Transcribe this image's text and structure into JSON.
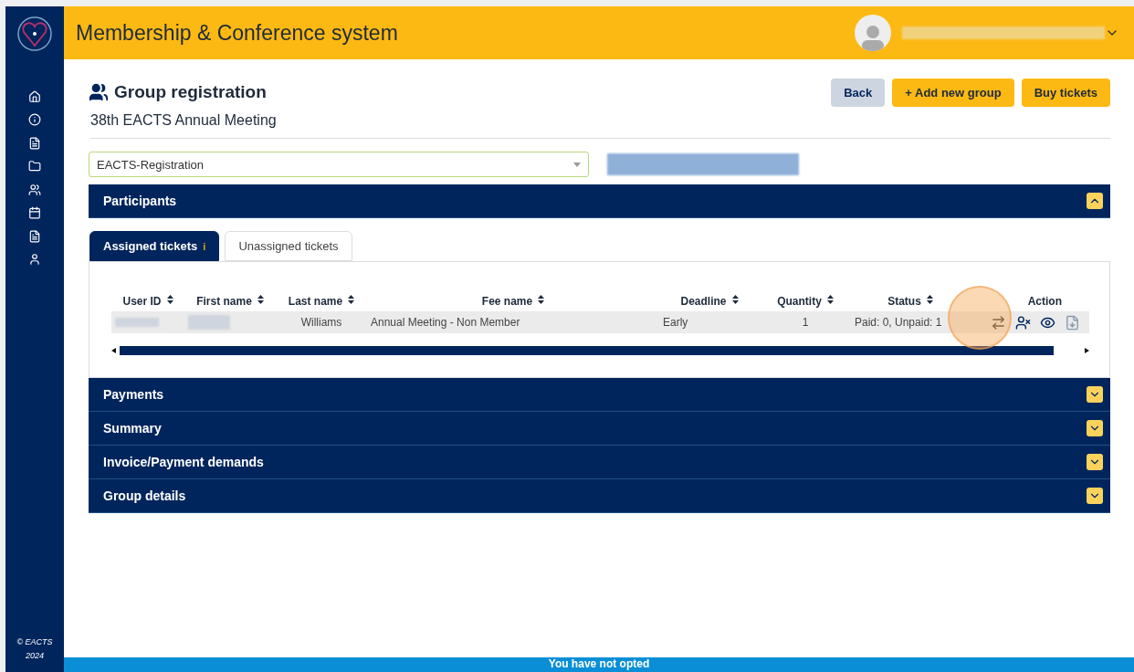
{
  "header": {
    "title": "Membership & Conference system"
  },
  "sidebar": {
    "copyright": [
      "© EACTS",
      "2024"
    ]
  },
  "page": {
    "title": "Group registration",
    "subtitle": "38th EACTS Annual Meeting",
    "buttons": [
      {
        "label": "Back",
        "kind": "secondary"
      },
      {
        "label": "+ Add new group",
        "kind": "primary"
      },
      {
        "label": "Buy tickets",
        "kind": "primary"
      }
    ],
    "select": {
      "value": "EACTS-Registration"
    }
  },
  "participants": {
    "title": "Participants",
    "expanded": true,
    "tabs": [
      {
        "label": "Assigned tickets",
        "selected": true,
        "info": "i"
      },
      {
        "label": "Unassigned tickets",
        "selected": false
      }
    ],
    "columns": [
      "User ID",
      "First name",
      "Last name",
      "Fee name",
      "Deadline",
      "Quantity",
      "Status",
      "Action"
    ],
    "rows": [
      {
        "last_name": "Williams",
        "fee_name": "Annual Meeting - Non Member",
        "deadline": "Early",
        "quantity": "1",
        "status": "Paid: 0, Unpaid: 1"
      }
    ]
  },
  "sections": [
    {
      "title": "Payments",
      "expanded": false
    },
    {
      "title": "Summary",
      "expanded": false
    },
    {
      "title": "Invoice/Payment demands",
      "expanded": false
    },
    {
      "title": "Group details",
      "expanded": false
    }
  ],
  "footer": {
    "banner": "You have not opted"
  }
}
